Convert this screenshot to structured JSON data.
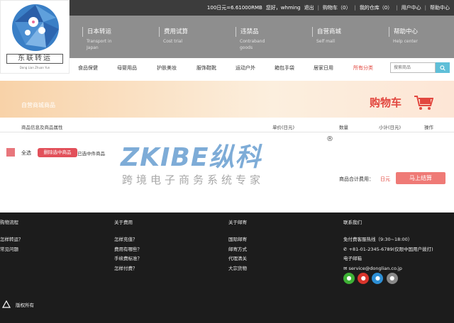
{
  "logo": {
    "text": "东联转运",
    "sub": "Dong Lian Zhuan Yun"
  },
  "topbar": {
    "rate": "100日元=6.61000RMB",
    "hello": "您好，whming",
    "logout": "退出",
    "cart": "购物车（0）",
    "warehouse": "我的仓库（0）",
    "sep": "|",
    "user_center": "用户中心",
    "help_center": "帮助中心"
  },
  "nav": [
    {
      "zh": "日本转运",
      "en": "Transport in Japan"
    },
    {
      "zh": "费用试算",
      "en": "Cost trial"
    },
    {
      "zh": "违禁品",
      "en": "Contraband goods"
    },
    {
      "zh": "自营商城",
      "en": "Self mall"
    },
    {
      "zh": "帮助中心",
      "en": "Help center"
    }
  ],
  "categories": [
    "食品保健",
    "母婴用品",
    "护肤美妆",
    "服饰鞋靴",
    "运动户外",
    "箱包手袋",
    "居家日用",
    "所有分类"
  ],
  "search": {
    "placeholder": "搜索商品"
  },
  "banner": {
    "title": "自营商城商品",
    "cart": "购物车"
  },
  "table": {
    "headers": [
      "商品信息及商品属性",
      "单价(日元)",
      "数量",
      "小计(日元)",
      "操作"
    ]
  },
  "cart": {
    "select_all": "全选",
    "delete": "删除选中商品",
    "selected": "已选中件商品",
    "total_label": "商品合计费用：",
    "total_value": "日元",
    "checkout": "马上结算"
  },
  "watermark": {
    "brand": "ZKIBE纵科",
    "registered": "®",
    "slogan": "跨境电子商务系统专家"
  },
  "footer": {
    "columns": [
      {
        "title": "购物流程",
        "items": [
          "怎样转运？",
          "常见问题"
        ]
      },
      {
        "title": "关于费用",
        "items": [
          "怎样充值？",
          "费用有哪些？",
          "手续费标准？",
          "怎样付费？"
        ]
      },
      {
        "title": "关于邮寄",
        "items": [
          "国际邮寄",
          "邮寄方式",
          "代理清关",
          "大宗货物"
        ]
      },
      {
        "title": "联系我们",
        "items": [
          "免付费客服热线（9:30~18:00）",
          "+81-01-2345-6789(仅限中国用户拨打)",
          "电子邮箱",
          "service@donglian.co.jp"
        ]
      }
    ],
    "copyright": "版权所有"
  },
  "colors": {
    "topbar": "#3c3c3c",
    "nav": "#8e8e8e",
    "accent": "#e2473f",
    "button": "#ef7a76",
    "footer": "#1c1c1c"
  }
}
